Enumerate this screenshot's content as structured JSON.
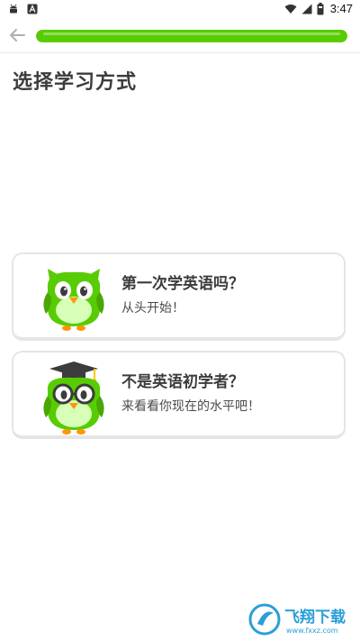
{
  "status_bar": {
    "time": "3:47",
    "icons_left": [
      "android-icon",
      "notification-a-icon"
    ],
    "icons_right": [
      "wifi-icon",
      "signal-icon",
      "battery-icon"
    ]
  },
  "header": {
    "back_icon": "arrow-left-icon",
    "progress": 1.0,
    "progress_color": "#58cc02"
  },
  "page": {
    "title": "选择学习方式"
  },
  "options": [
    {
      "title": "第一次学英语吗？",
      "subtitle": "从头开始！",
      "illustration": "owl-icon"
    },
    {
      "title": "不是英语初学者？",
      "subtitle": "来看看你现在的水平吧！",
      "illustration": "owl-graduate-icon"
    }
  ],
  "watermark": {
    "text": "飞翔下载",
    "site": "www.fxxz.com",
    "color": "#2a9fd8"
  }
}
